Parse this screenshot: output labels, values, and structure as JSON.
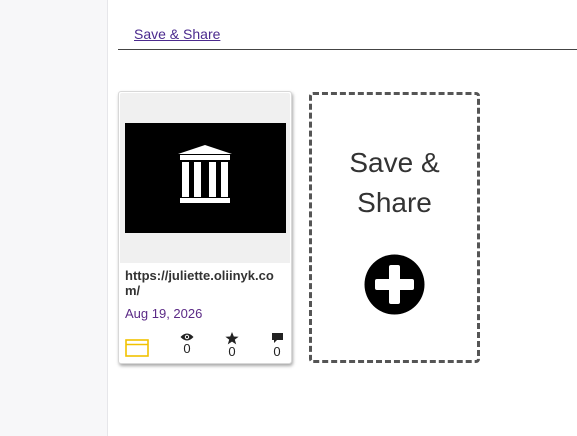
{
  "header": {
    "link_label": " Save & Share"
  },
  "card": {
    "url": "https://juliette.oliinyk.com/",
    "date": "Aug 19, 2026",
    "stats": {
      "views": "0",
      "stars": "0",
      "comments": "0"
    },
    "thumbnail_icon": "museum-icon",
    "type_icon": "browser-window-icon"
  },
  "add_card": {
    "title_line1": "Save &",
    "title_line2": "Share",
    "icon": "plus-circle-icon"
  },
  "colors": {
    "accent": "#5b2a86",
    "type_icon": "#f2c200"
  }
}
